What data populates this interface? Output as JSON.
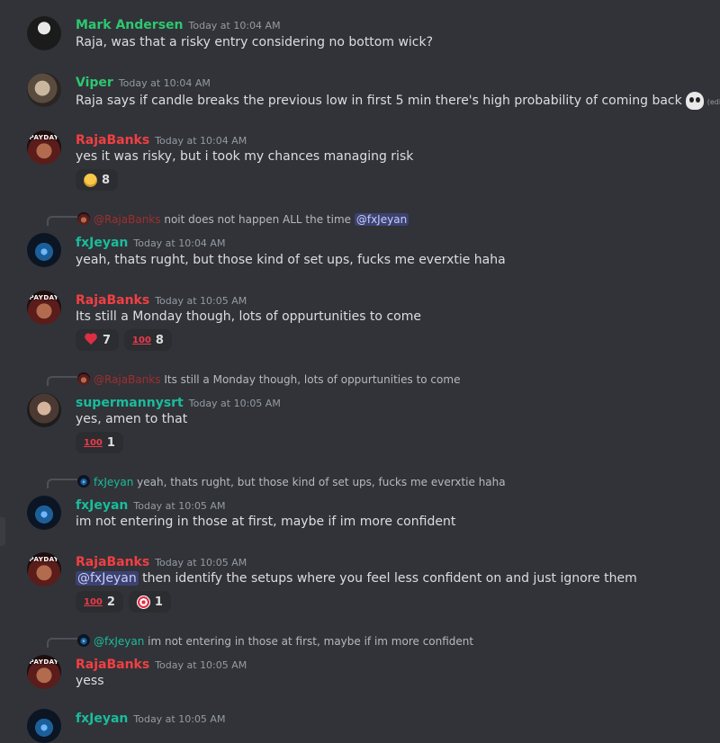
{
  "colors": {
    "background": "#313338",
    "text": "#dbdee1",
    "muted": "#949ba4",
    "green_name": "#2dc770",
    "red_name": "#f23f42",
    "mention_bg": "#3c4270"
  },
  "messages": [
    {
      "author": "Mark Andersen",
      "time": "Today at 10:04 AM",
      "text": "Raja, was that a risky entry considering no bottom wick?"
    },
    {
      "author": "Viper",
      "time": "Today at 10:04 AM",
      "text": "Raja says if candle breaks the previous low in first 5 min there's high probability of coming back",
      "emoji": "skull-emoji",
      "edited": "(edited)"
    },
    {
      "author": "RajaBanks",
      "time": "Today at 10:04 AM",
      "text": "yes it was risky, but i took my chances managing risk",
      "avatar_badge": "PAYDAY",
      "reactions": [
        {
          "emoji": "saluting-face",
          "count": "8"
        }
      ]
    },
    {
      "reply": {
        "mention": "@RajaBanks",
        "text": "noit does not happen ALL the time",
        "mention_end": "@fxJeyan"
      },
      "author": "fxJeyan",
      "time": "Today at 10:04 AM",
      "text": "yeah, thats rught, but those kind of set ups, fucks me everxtie haha"
    },
    {
      "author": "RajaBanks",
      "time": "Today at 10:05 AM",
      "text": "Its still a Monday though, lots of oppurtunities to come",
      "avatar_badge": "PAYDAY",
      "reactions": [
        {
          "emoji": "heart",
          "count": "7"
        },
        {
          "emoji": "100",
          "count": "8"
        }
      ]
    },
    {
      "reply": {
        "mention": "@RajaBanks",
        "text": "Its still a Monday though, lots of oppurtunities to come"
      },
      "author": "supermannysrt",
      "time": "Today at 10:05 AM",
      "text": "yes, amen to that",
      "reactions": [
        {
          "emoji": "100",
          "count": "1"
        }
      ]
    },
    {
      "reply": {
        "mention": "fxJeyan",
        "text": "yeah, thats rught, but those kind of set ups, fucks me everxtie haha"
      },
      "author": "fxJeyan",
      "time": "Today at 10:05 AM",
      "text": "im not entering in those at first, maybe if im more confident"
    },
    {
      "author": "RajaBanks",
      "time": "Today at 10:05 AM",
      "mention": "@fxJeyan",
      "text": "then identify the setups where you feel less confident on and just ignore them",
      "avatar_badge": "PAYDAY",
      "reactions": [
        {
          "emoji": "100",
          "count": "2"
        },
        {
          "emoji": "direct-hit",
          "count": "1"
        }
      ]
    },
    {
      "reply": {
        "mention": "@fxJeyan",
        "text": "im not entering in those at first, maybe if im more confident"
      },
      "author": "RajaBanks",
      "time": "Today at 10:05 AM",
      "text": "yess",
      "avatar_badge": "PAYDAY"
    },
    {
      "author": "fxJeyan",
      "time": "Today at 10:05 AM"
    }
  ],
  "emoji_text": {
    "hundred": "100"
  }
}
